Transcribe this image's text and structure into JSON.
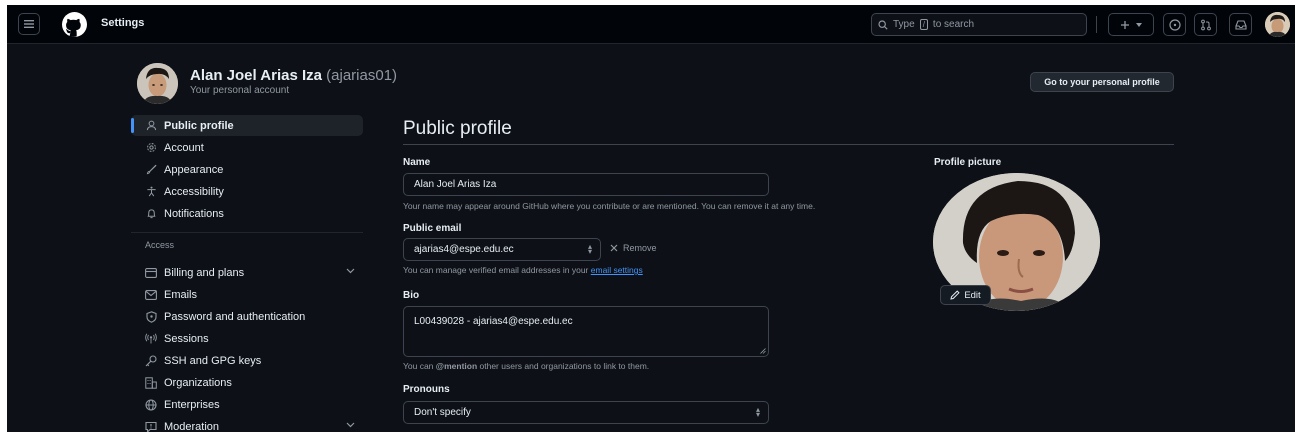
{
  "header": {
    "title": "Settings",
    "search_label": "Type",
    "search_key": "/",
    "search_suffix": "to search",
    "create_icon": "plus-icon",
    "issues_icon": "issue-opened-icon",
    "pulls_icon": "git-pull-request-icon",
    "inbox_icon": "inbox-icon"
  },
  "account": {
    "name": "Alan Joel Arias Iza",
    "login": "(ajarias01)",
    "subtitle": "Your personal account",
    "profile_button": "Go to your personal profile"
  },
  "sidebar": {
    "items": [
      {
        "label": "Public profile",
        "icon": "person-icon",
        "active": true
      },
      {
        "label": "Account",
        "icon": "gear-icon"
      },
      {
        "label": "Appearance",
        "icon": "paintbrush-icon"
      },
      {
        "label": "Accessibility",
        "icon": "accessibility-icon"
      },
      {
        "label": "Notifications",
        "icon": "bell-icon"
      }
    ],
    "access_heading": "Access",
    "access_items": [
      {
        "label": "Billing and plans",
        "icon": "credit-card-icon",
        "expandable": true
      },
      {
        "label": "Emails",
        "icon": "mail-icon"
      },
      {
        "label": "Password and authentication",
        "icon": "shield-lock-icon"
      },
      {
        "label": "Sessions",
        "icon": "broadcast-icon"
      },
      {
        "label": "SSH and GPG keys",
        "icon": "key-icon"
      },
      {
        "label": "Organizations",
        "icon": "organization-icon"
      },
      {
        "label": "Enterprises",
        "icon": "globe-icon"
      },
      {
        "label": "Moderation",
        "icon": "report-icon",
        "expandable": true
      }
    ]
  },
  "main": {
    "title": "Public profile",
    "name_label": "Name",
    "name_value": "Alan Joel Arias Iza",
    "name_hint": "Your name may appear around GitHub where you contribute or are mentioned. You can remove it at any time.",
    "email_label": "Public email",
    "email_value": "ajarias4@espe.edu.ec",
    "remove_label": "Remove",
    "email_hint": "You can manage verified email addresses in your",
    "email_hint_link": "email settings",
    "bio_label": "Bio",
    "bio_value": "L00439028 - ajarias4@espe.edu.ec",
    "bio_hint_prefix": "You can",
    "bio_hint_mention": "@mention",
    "bio_hint_suffix": "other users and organizations to link to them.",
    "pronouns_label": "Pronouns",
    "pronouns_value": "Don't specify"
  },
  "profile_picture": {
    "label": "Profile picture",
    "edit_label": "Edit"
  },
  "colors": {
    "background": "#0d1117",
    "header": "#010409",
    "accent": "#4493f8",
    "text": "#e6edf3",
    "muted": "#9198a1",
    "border": "#3d444d"
  }
}
